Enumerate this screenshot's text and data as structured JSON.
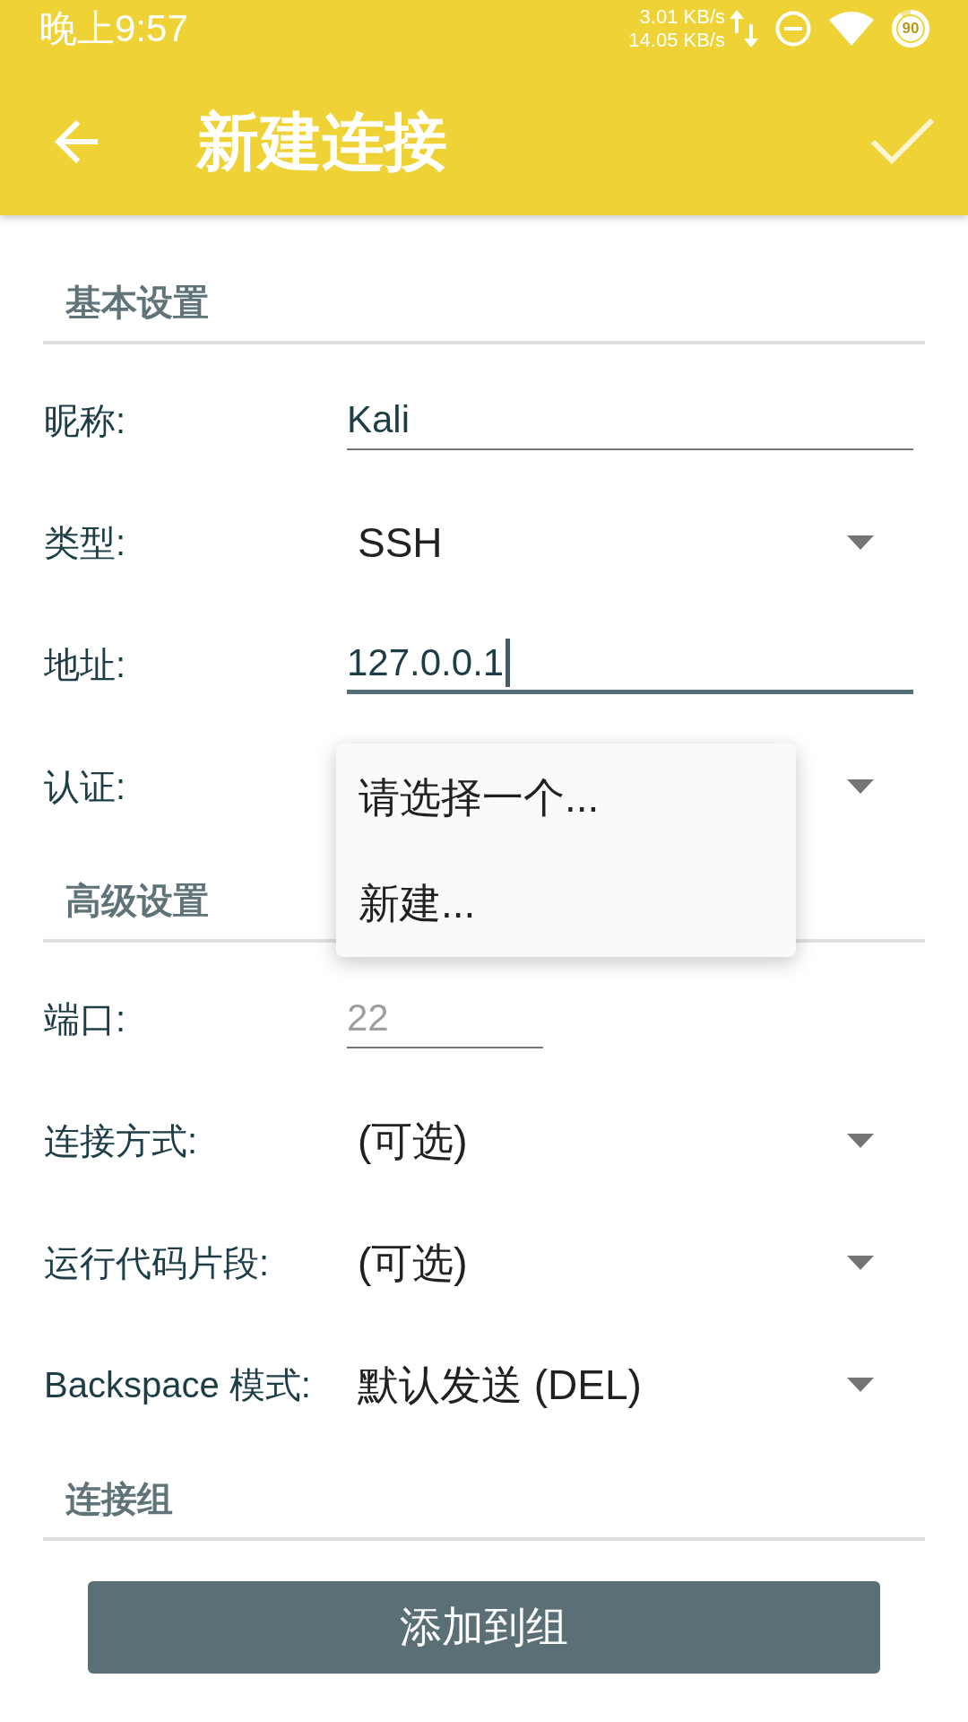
{
  "status_bar": {
    "time": "晚上9:57",
    "upload_speed": "3.01 KB/s",
    "download_speed": "14.05 KB/s",
    "battery": "90"
  },
  "app_bar": {
    "title": "新建连接"
  },
  "sections": [
    {
      "title": "基本设置",
      "fields": [
        {
          "kind": "text",
          "label": "昵称:",
          "value": "Kali",
          "focused": false
        },
        {
          "kind": "spinner",
          "label": "类型:",
          "value": "SSH"
        },
        {
          "kind": "text",
          "label": "地址:",
          "value": "127.0.0.1",
          "focused": true
        },
        {
          "kind": "spinner",
          "label": "认证:",
          "dropdown": [
            "请选择一个...",
            "新建..."
          ]
        }
      ]
    },
    {
      "title": "高级设置",
      "fields": [
        {
          "kind": "number",
          "label": "端口:",
          "placeholder": "22",
          "focused": false
        },
        {
          "kind": "spinner",
          "label": "连接方式:",
          "value": "(可选)"
        },
        {
          "kind": "spinner",
          "label": "运行代码片段:",
          "value": "(可选)"
        },
        {
          "kind": "spinner",
          "label": "Backspace 模式:",
          "value": "默认发送 (DEL)"
        }
      ]
    },
    {
      "title": "连接组",
      "button": "添加到组"
    }
  ]
}
